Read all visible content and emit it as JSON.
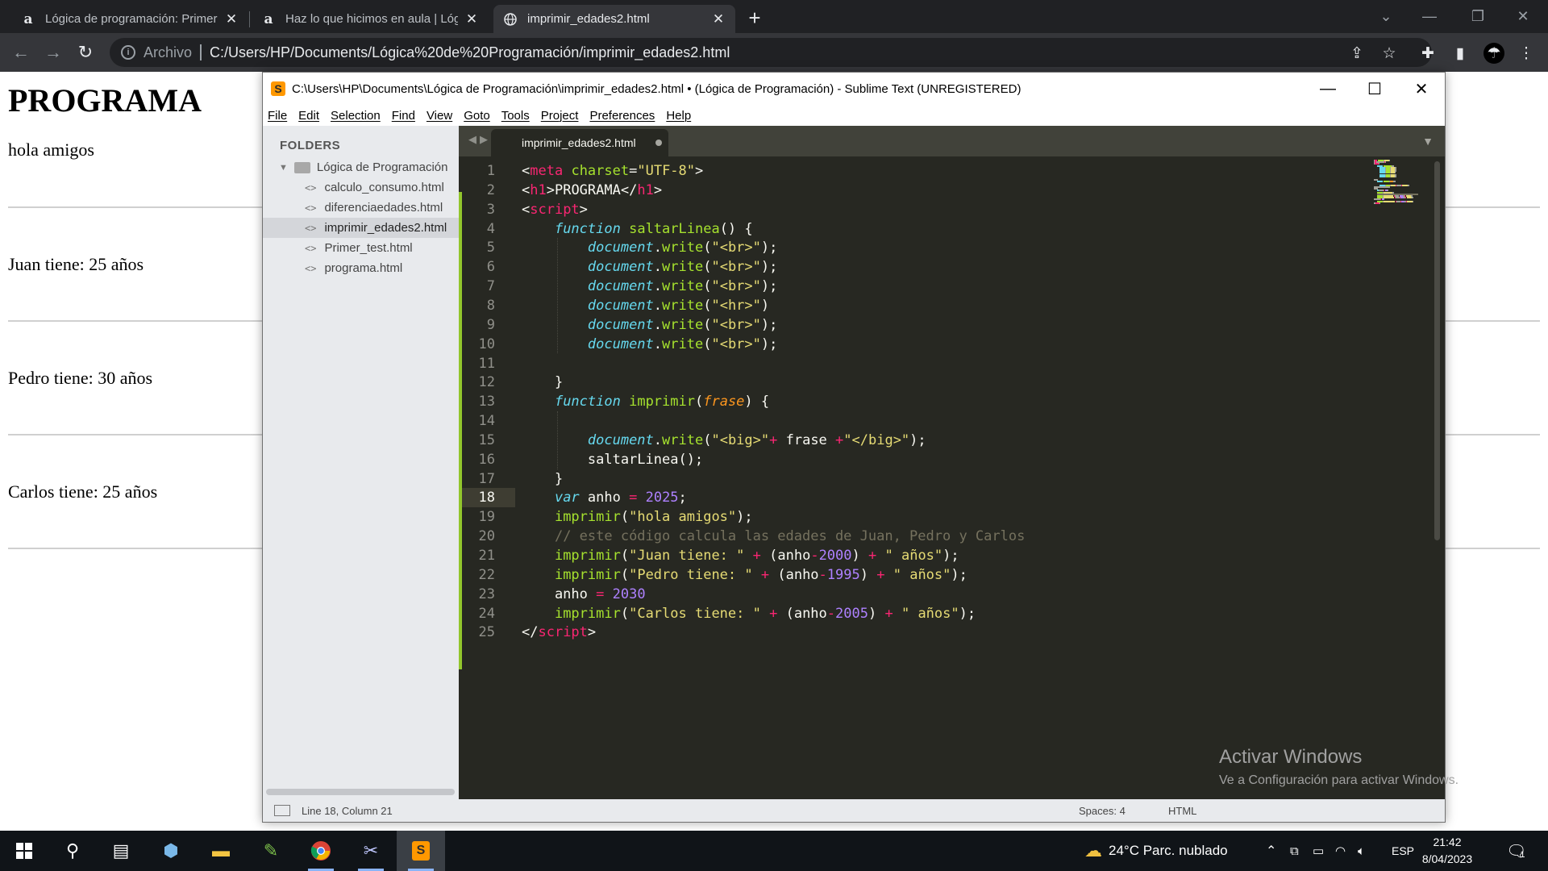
{
  "browser": {
    "tabs": [
      {
        "icon": "a",
        "title": "Lógica de programación: Primero"
      },
      {
        "icon": "a",
        "title": "Haz lo que hicimos en aula | Lógi"
      },
      {
        "icon": "globe",
        "title": "imprimir_edades2.html"
      }
    ],
    "address": {
      "scheme_label": "Archivo",
      "url": "C:/Users/HP/Documents/Lógica%20de%20Programación/imprimir_edades2.html"
    }
  },
  "page": {
    "heading": "PROGRAMA",
    "lines": [
      "hola amigos",
      "Juan tiene: 25 años",
      "Pedro tiene: 30 años",
      "Carlos tiene: 25 años"
    ]
  },
  "sublime": {
    "title": "C:\\Users\\HP\\Documents\\Lógica de Programación\\imprimir_edades2.html • (Lógica de Programación) - Sublime Text (UNREGISTERED)",
    "menu": [
      "File",
      "Edit",
      "Selection",
      "Find",
      "View",
      "Goto",
      "Tools",
      "Project",
      "Preferences",
      "Help"
    ],
    "sidebar": {
      "header": "FOLDERS",
      "folder": "Lógica de Programación",
      "files": [
        "calculo_consumo.html",
        "diferenciaedades.html",
        "imprimir_edades2.html",
        "Primer_test.html",
        "programa.html"
      ]
    },
    "editor_tab": "imprimir_edades2.html",
    "code_lines": [
      [
        [
          "t-pl",
          "<"
        ],
        [
          "t-tag",
          "meta"
        ],
        [
          "t-pl",
          " "
        ],
        [
          "t-attr",
          "charset"
        ],
        [
          "t-pl",
          "="
        ],
        [
          "t-str",
          "\"UTF-8\""
        ],
        [
          "t-pl",
          ">"
        ]
      ],
      [
        [
          "t-pl",
          "<"
        ],
        [
          "t-tag",
          "h1"
        ],
        [
          "t-pl",
          ">PROGRAMA</"
        ],
        [
          "t-tag",
          "h1"
        ],
        [
          "t-pl",
          ">"
        ]
      ],
      [
        [
          "t-pl",
          "<"
        ],
        [
          "t-tag",
          "script"
        ],
        [
          "t-pl",
          ">"
        ]
      ],
      [
        [
          "t-pl",
          "    "
        ],
        [
          "t-kw",
          "function"
        ],
        [
          "t-pl",
          " "
        ],
        [
          "t-fn",
          "saltarLinea"
        ],
        [
          "t-pl",
          "() {"
        ]
      ],
      [
        [
          "t-pl",
          "        "
        ],
        [
          "t-obj",
          "document"
        ],
        [
          "t-pl",
          "."
        ],
        [
          "t-fn",
          "write"
        ],
        [
          "t-pl",
          "("
        ],
        [
          "t-str",
          "\"<br>\""
        ],
        [
          "t-pl",
          ");"
        ]
      ],
      [
        [
          "t-pl",
          "        "
        ],
        [
          "t-obj",
          "document"
        ],
        [
          "t-pl",
          "."
        ],
        [
          "t-fn",
          "write"
        ],
        [
          "t-pl",
          "("
        ],
        [
          "t-str",
          "\"<br>\""
        ],
        [
          "t-pl",
          ");"
        ]
      ],
      [
        [
          "t-pl",
          "        "
        ],
        [
          "t-obj",
          "document"
        ],
        [
          "t-pl",
          "."
        ],
        [
          "t-fn",
          "write"
        ],
        [
          "t-pl",
          "("
        ],
        [
          "t-str",
          "\"<br>\""
        ],
        [
          "t-pl",
          ");"
        ]
      ],
      [
        [
          "t-pl",
          "        "
        ],
        [
          "t-obj",
          "document"
        ],
        [
          "t-pl",
          "."
        ],
        [
          "t-fn",
          "write"
        ],
        [
          "t-pl",
          "("
        ],
        [
          "t-str",
          "\"<hr>\""
        ],
        [
          "t-pl",
          ")"
        ]
      ],
      [
        [
          "t-pl",
          "        "
        ],
        [
          "t-obj",
          "document"
        ],
        [
          "t-pl",
          "."
        ],
        [
          "t-fn",
          "write"
        ],
        [
          "t-pl",
          "("
        ],
        [
          "t-str",
          "\"<br>\""
        ],
        [
          "t-pl",
          ");"
        ]
      ],
      [
        [
          "t-pl",
          "        "
        ],
        [
          "t-obj",
          "document"
        ],
        [
          "t-pl",
          "."
        ],
        [
          "t-fn",
          "write"
        ],
        [
          "t-pl",
          "("
        ],
        [
          "t-str",
          "\"<br>\""
        ],
        [
          "t-pl",
          ");"
        ]
      ],
      [],
      [
        [
          "t-pl",
          "    }"
        ]
      ],
      [
        [
          "t-pl",
          "    "
        ],
        [
          "t-kw",
          "function"
        ],
        [
          "t-pl",
          " "
        ],
        [
          "t-fn",
          "imprimir"
        ],
        [
          "t-pl",
          "("
        ],
        [
          "t-par",
          "frase"
        ],
        [
          "t-pl",
          ") {"
        ]
      ],
      [],
      [
        [
          "t-pl",
          "        "
        ],
        [
          "t-obj",
          "document"
        ],
        [
          "t-pl",
          "."
        ],
        [
          "t-fn",
          "write"
        ],
        [
          "t-pl",
          "("
        ],
        [
          "t-str",
          "\"<big>\""
        ],
        [
          "t-op",
          "+"
        ],
        [
          "t-pl",
          " frase "
        ],
        [
          "t-op",
          "+"
        ],
        [
          "t-str",
          "\"</big>\""
        ],
        [
          "t-pl",
          ");"
        ]
      ],
      [
        [
          "t-pl",
          "        saltarLinea();"
        ]
      ],
      [
        [
          "t-pl",
          "    }"
        ]
      ],
      [
        [
          "t-pl",
          "    "
        ],
        [
          "t-kw",
          "var"
        ],
        [
          "t-pl",
          " anho "
        ],
        [
          "t-op",
          "="
        ],
        [
          "t-pl",
          " "
        ],
        [
          "t-num",
          "2025"
        ],
        [
          "t-pl",
          ";"
        ]
      ],
      [
        [
          "t-pl",
          "    "
        ],
        [
          "t-fn",
          "imprimir"
        ],
        [
          "t-pl",
          "("
        ],
        [
          "t-str",
          "\"hola amigos\""
        ],
        [
          "t-pl",
          ");"
        ]
      ],
      [
        [
          "t-pl",
          "    "
        ],
        [
          "t-com",
          "// este código calcula las edades de Juan, Pedro y Carlos"
        ]
      ],
      [
        [
          "t-pl",
          "    "
        ],
        [
          "t-fn",
          "imprimir"
        ],
        [
          "t-pl",
          "("
        ],
        [
          "t-str",
          "\"Juan tiene: \""
        ],
        [
          "t-pl",
          " "
        ],
        [
          "t-op",
          "+"
        ],
        [
          "t-pl",
          " (anho"
        ],
        [
          "t-op",
          "-"
        ],
        [
          "t-num",
          "2000"
        ],
        [
          "t-pl",
          ") "
        ],
        [
          "t-op",
          "+"
        ],
        [
          "t-pl",
          " "
        ],
        [
          "t-str",
          "\" años\""
        ],
        [
          "t-pl",
          ");"
        ]
      ],
      [
        [
          "t-pl",
          "    "
        ],
        [
          "t-fn",
          "imprimir"
        ],
        [
          "t-pl",
          "("
        ],
        [
          "t-str",
          "\"Pedro tiene: \""
        ],
        [
          "t-pl",
          " "
        ],
        [
          "t-op",
          "+"
        ],
        [
          "t-pl",
          " (anho"
        ],
        [
          "t-op",
          "-"
        ],
        [
          "t-num",
          "1995"
        ],
        [
          "t-pl",
          ") "
        ],
        [
          "t-op",
          "+"
        ],
        [
          "t-pl",
          " "
        ],
        [
          "t-str",
          "\" años\""
        ],
        [
          "t-pl",
          ");"
        ]
      ],
      [
        [
          "t-pl",
          "    anho "
        ],
        [
          "t-op",
          "="
        ],
        [
          "t-pl",
          " "
        ],
        [
          "t-num",
          "2030"
        ]
      ],
      [
        [
          "t-pl",
          "    "
        ],
        [
          "t-fn",
          "imprimir"
        ],
        [
          "t-pl",
          "("
        ],
        [
          "t-str",
          "\"Carlos tiene: \""
        ],
        [
          "t-pl",
          " "
        ],
        [
          "t-op",
          "+"
        ],
        [
          "t-pl",
          " (anho"
        ],
        [
          "t-op",
          "-"
        ],
        [
          "t-num",
          "2005"
        ],
        [
          "t-pl",
          ") "
        ],
        [
          "t-op",
          "+"
        ],
        [
          "t-pl",
          " "
        ],
        [
          "t-str",
          "\" años\""
        ],
        [
          "t-pl",
          ");"
        ]
      ],
      [
        [
          "t-pl",
          "</"
        ],
        [
          "t-tag",
          "script"
        ],
        [
          "t-pl",
          ">"
        ]
      ]
    ],
    "current_line": 18,
    "status": {
      "position": "Line 18, Column 21",
      "spaces": "Spaces: 4",
      "syntax": "HTML"
    },
    "watermark": {
      "line1": "Activar Windows",
      "line2": "Ve a Configuración para activar Windows."
    }
  },
  "taskbar": {
    "weather": "24°C  Parc. nublado",
    "lang": "ESP",
    "time": "21:42",
    "date": "8/04/2023",
    "notification_count": "1"
  }
}
